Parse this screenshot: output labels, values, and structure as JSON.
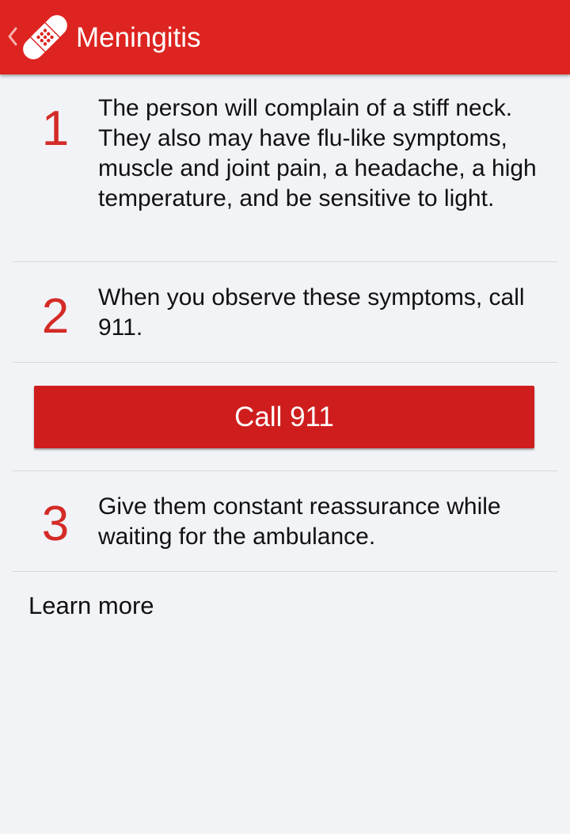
{
  "header": {
    "title": "Meningitis",
    "back_icon": "chevron-left-icon",
    "app_icon": "bandage-icon",
    "background_color": "#dd2420"
  },
  "steps": [
    {
      "number": "1",
      "text": "The person will complain of a stiff neck. They also may have flu-like symptoms, muscle and joint pain, a headache, a high temperature, and be sensitive to light."
    },
    {
      "number": "2",
      "text": "When you observe these symptoms, call 911."
    },
    {
      "number": "3",
      "text": "Give them constant reassurance while waiting for the ambulance."
    }
  ],
  "call_button": {
    "label": "Call 911",
    "color": "#cf1d1d"
  },
  "learn_more": {
    "label": "Learn more"
  },
  "accent_color": "#d42b27"
}
